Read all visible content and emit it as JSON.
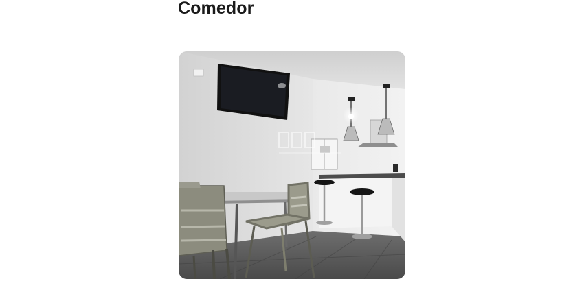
{
  "section": {
    "title": "Comedor"
  },
  "photo": {
    "subject": "dining-room-photo"
  }
}
